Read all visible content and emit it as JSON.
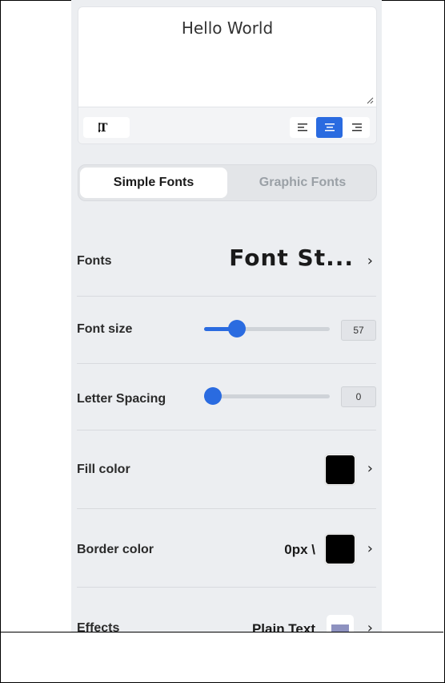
{
  "editor": {
    "text_value": "Hello World",
    "format_icon": "text-format-icon",
    "align_icons": [
      "align-left-icon",
      "align-center-icon",
      "align-right-icon"
    ],
    "active_align": "center"
  },
  "tabs": {
    "simple": "Simple Fonts",
    "graphic": "Graphic Fonts"
  },
  "fonts": {
    "label": "Fonts",
    "preview": "Font St..."
  },
  "font_size": {
    "label": "Font size",
    "value": "57",
    "level": 0.22
  },
  "letter_spacing": {
    "label": "Letter Spacing",
    "value": "0",
    "level": 0
  },
  "fill_color": {
    "label": "Fill color",
    "color": "#000000"
  },
  "border_color": {
    "label": "Border color",
    "width": "0px \\",
    "color": "#000000"
  },
  "effects": {
    "label": "Effects",
    "value": "Plain Text"
  },
  "chevron": "›",
  "colors": {
    "accent": "#2a6be0",
    "panel": "#eceef1"
  }
}
